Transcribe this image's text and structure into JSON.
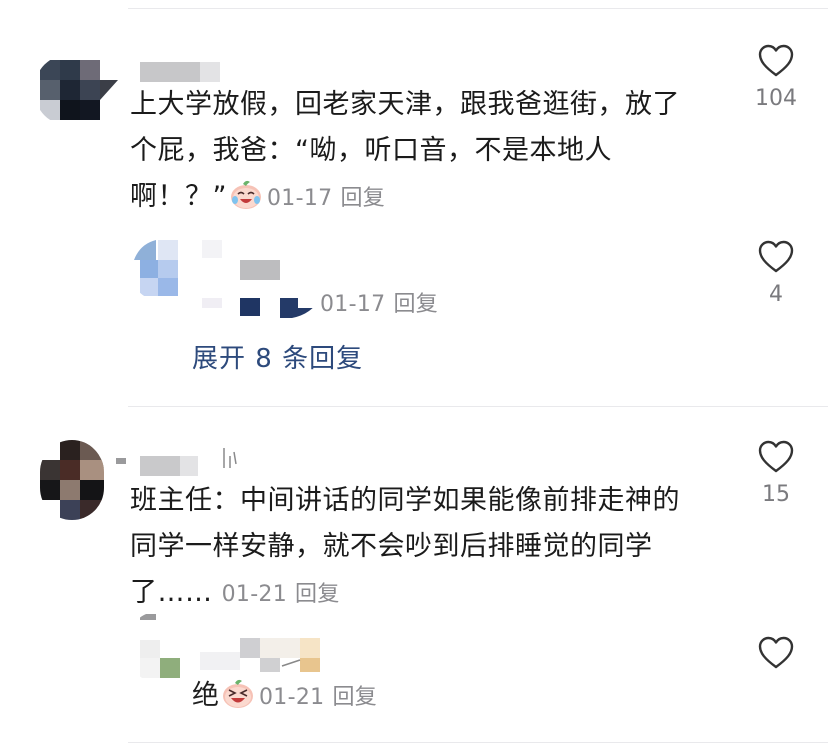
{
  "comments": [
    {
      "text_lines": [
        "上大学放假，回老家天津，跟我爸逛街，放了",
        "个屁，我爸：“呦，听口音，不是本地人",
        "啊！？”"
      ],
      "date": "01-17",
      "reply_label": "回复",
      "likes": "104",
      "emoji": "crying-laugh-peach-emoji",
      "replies": [
        {
          "date": "01-17",
          "reply_label": "回复",
          "likes": "4"
        }
      ],
      "expand_label": "展开 8 条回复"
    },
    {
      "text_lines": [
        "班主任：中间讲话的同学如果能像前排走神的",
        "同学一样安静，就不会吵到后排睡觉的同学",
        "了……"
      ],
      "date": "01-21",
      "reply_label": "回复",
      "likes": "15",
      "replies": [
        {
          "text": "绝",
          "emoji": "laughing-peach-emoji",
          "date": "01-21",
          "reply_label": "回复",
          "likes": ""
        }
      ]
    }
  ],
  "colors": {
    "link": "#2d4a7c",
    "meta": "#8b8b8f",
    "divider": "#e9e9ec"
  },
  "icons": {
    "like": "heart-outline-icon"
  }
}
